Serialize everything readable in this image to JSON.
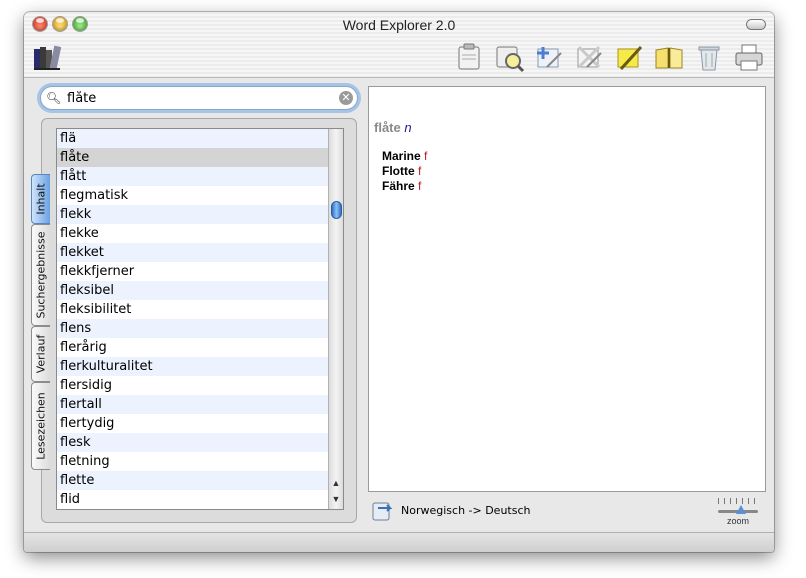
{
  "window": {
    "title": "Word Explorer 2.0"
  },
  "toolbar": {
    "left_icon": "books-icon",
    "icons": [
      "clipboard-icon",
      "magnifier-book-icon",
      "add-entry-icon",
      "remove-entry-icon",
      "edit-note-icon",
      "open-book-icon",
      "trash-icon",
      "printer-icon"
    ]
  },
  "search": {
    "value": "flåte",
    "icon": "search-icon",
    "clear_icon": "clear-icon"
  },
  "tabs": [
    "Inhalt",
    "Suchergebnisse",
    "Verlauf",
    "Lesezeichen"
  ],
  "active_tab": "Inhalt",
  "wordlist": {
    "items": [
      "flä",
      "flåte",
      "flått",
      "flegmatisk",
      "flekk",
      "flekke",
      "flekket",
      "flekkfjerner",
      "fleksibel",
      "fleksibilitet",
      "flens",
      "flerårig",
      "flerkulturalitet",
      "flersidig",
      "flertall",
      "flertydig",
      "flesk",
      "fletning",
      "flette",
      "flid"
    ],
    "selected": "flåte"
  },
  "entry": {
    "headword": "flåte",
    "pos": "n",
    "translations": [
      {
        "word": "Marine",
        "gender": "f"
      },
      {
        "word": "Flotte",
        "gender": "f"
      },
      {
        "word": "Fähre",
        "gender": "f"
      }
    ]
  },
  "status": {
    "direction": "Norwegisch -> Deutsch",
    "zoom_label": "zoom"
  },
  "colors": {
    "selection": "#d4d4d4",
    "alt_row": "#edf3fe",
    "gender": "#b22222",
    "pos": "#1a1a8a"
  }
}
